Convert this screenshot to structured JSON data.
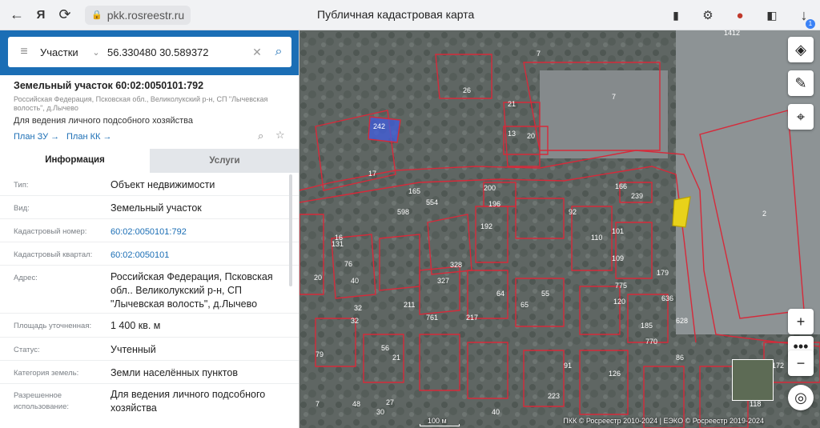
{
  "browser": {
    "url": "pkk.rosreestr.ru",
    "title": "Публичная кадастровая карта",
    "download_count": "1"
  },
  "search": {
    "category": "Участки",
    "query": "56.330480 30.589372"
  },
  "parcel": {
    "title": "Земельный участок 60:02:0050101:792",
    "region": "Российская Федерация, Псковская обл., Великолукский р-н, СП \"Лычевская волость\", д.Лычево",
    "purpose": "Для ведения личного подсобного хозяйства",
    "link_zu": "План ЗУ →",
    "link_kk": "План КК →"
  },
  "tabs": {
    "info": "Информация",
    "services": "Услуги"
  },
  "info_rows": [
    {
      "label": "Тип:",
      "value": "Объект недвижимости"
    },
    {
      "label": "Вид:",
      "value": "Земельный участок"
    },
    {
      "label": "Кадастровый номер:",
      "value": "60:02:0050101:792"
    },
    {
      "label": "Кадастровый квартал:",
      "value": "60:02:0050101"
    },
    {
      "label": "Адрес:",
      "value": "Российская Федерация, Псковская обл.. Великолукский р-н, СП \"Лычевская волость\", д.Лычево"
    },
    {
      "label": "Площадь уточненная:",
      "value": "1 400 кв. м"
    },
    {
      "label": "Статус:",
      "value": "Учтенный"
    },
    {
      "label": "Категория земель:",
      "value": "Земли населённых пунктов"
    },
    {
      "label": "Разрешенное использование:",
      "value": "Для ведения личного подсобного хозяйства"
    }
  ],
  "map": {
    "scale_label": "100 м",
    "copyright": "ПКК © Росреестр 2010-2024 | ЕЭКО © Росреестр 2019-2024",
    "parcel_labels": [
      "1412",
      "7",
      "26",
      "7",
      "21",
      "242",
      "13",
      "20",
      "17",
      "165",
      "200",
      "239",
      "166",
      "554",
      "598",
      "196",
      "192",
      "2",
      "131",
      "92",
      "110",
      "101",
      "109",
      "16",
      "76",
      "40",
      "328",
      "327",
      "775",
      "179",
      "636",
      "20",
      "211",
      "64",
      "65",
      "55",
      "120",
      "628",
      "761",
      "217",
      "185",
      "770",
      "32",
      "32",
      "56",
      "21",
      "79",
      "126",
      "223",
      "40",
      "7",
      "48",
      "27",
      "30",
      "91",
      "172",
      "118",
      "86"
    ],
    "colors": {
      "parcel_border": "#d62a3a",
      "selected_fill": "#e8d21a",
      "blue_fill": "#3f5de0"
    }
  }
}
